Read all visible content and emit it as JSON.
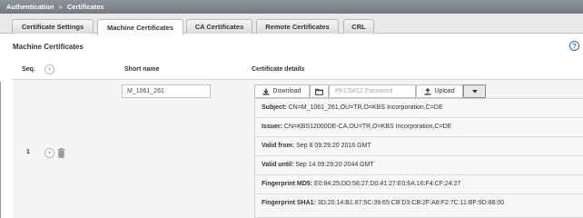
{
  "breadcrumb": {
    "parent": "Authentication",
    "separator": "»",
    "current": "Certificates"
  },
  "tabs": [
    {
      "label": "Certificate Settings",
      "active": false
    },
    {
      "label": "Machine Certificates",
      "active": true
    },
    {
      "label": "CA Certificates",
      "active": false
    },
    {
      "label": "Remote Certificates",
      "active": false
    },
    {
      "label": "CRL",
      "active": false
    }
  ],
  "section": {
    "title": "Machine Certificates",
    "help_icon": "?"
  },
  "table": {
    "headers": {
      "seq": "Seq.",
      "short_name": "Short name",
      "details": "Certificate details"
    },
    "rows": [
      {
        "seq": "1",
        "short_name": "M_1061_261",
        "actions": {
          "download_label": "Download",
          "password_placeholder": "PKCS#12 Password",
          "upload_label": "Upload"
        },
        "details": {
          "subject_label": "Subject:",
          "subject": "CN=M_1061_261,OU=TR,O=KBS Incorporation,C=DE",
          "issuer_label": "Issuer:",
          "issuer": "CN=KBS12000DE-CA,OU=TR,O=KBS Incorporation,C=DE",
          "valid_from_label": "Valid from:",
          "valid_from": "Sep 8 09:29:20 2016 GMT",
          "valid_until_label": "Valid until:",
          "valid_until": "Sep 14 09:29:20 2044 GMT",
          "md5_label": "Fingerprint MD5:",
          "md5": "E0:84:25:DD:58:27:D0:41:27:E0:6A:16:F4:CF:24:27",
          "sha1_label": "Fingerprint SHA1:",
          "sha1": "3D:20:14:B1:87:5C:39:65:CB:D3:CB:2F:A8:F2:7C:11:BF:9D:88:00"
        }
      }
    ]
  },
  "colors": {
    "header_bar": "#7f868d",
    "help_blue": "#2f66b3",
    "row_background": "#f5f5f5"
  }
}
